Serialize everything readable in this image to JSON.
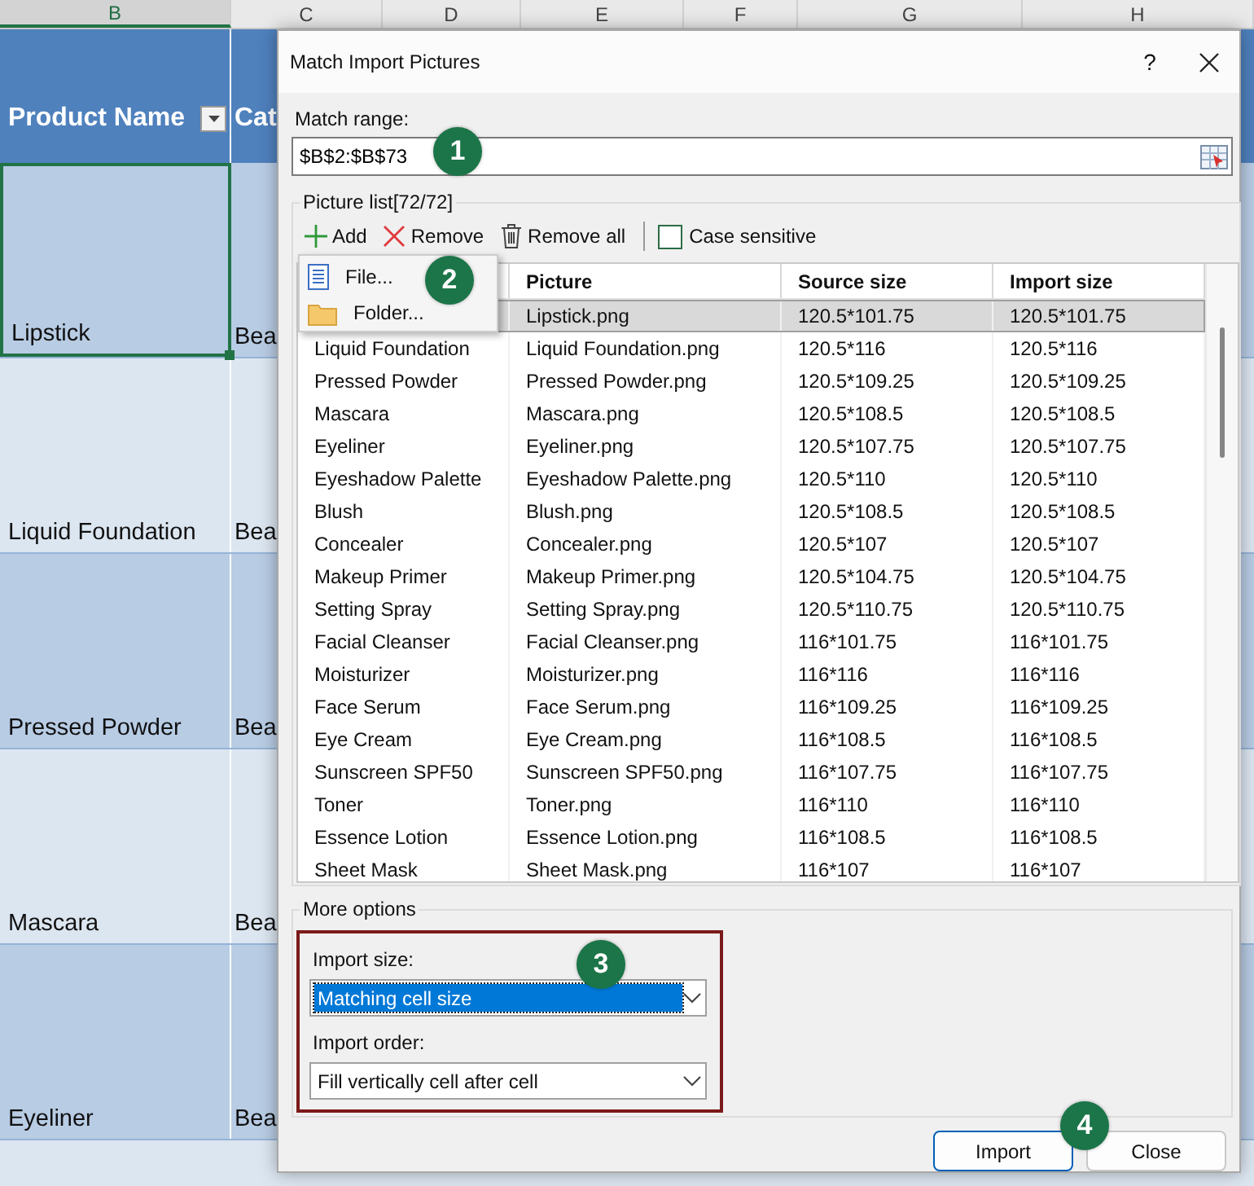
{
  "sheet": {
    "column_headers": [
      {
        "label": "B",
        "selected": true
      },
      {
        "label": "C",
        "selected": false
      },
      {
        "label": "D",
        "selected": false
      },
      {
        "label": "E",
        "selected": false
      },
      {
        "label": "F",
        "selected": false
      },
      {
        "label": "G",
        "selected": false
      },
      {
        "label": "H",
        "selected": false
      }
    ],
    "header_cells": [
      "Product Name",
      "Cat"
    ],
    "rows": [
      {
        "product": "Lipstick",
        "column_c": "Bea",
        "selected": true
      },
      {
        "product": "Liquid Foundation",
        "column_c": "Bea",
        "selected": false
      },
      {
        "product": "Pressed Powder",
        "column_c": "Bea",
        "selected": false
      },
      {
        "product": "Mascara",
        "column_c": "Bea",
        "selected": false
      },
      {
        "product": "Eyeliner",
        "column_c": "Bea",
        "selected": false
      }
    ]
  },
  "dialog": {
    "title": "Match Import Pictures",
    "help": "?",
    "match_range": {
      "label": "Match range:",
      "value": "$B$2:$B$73"
    },
    "picture_list": {
      "title": "Picture list[72/72]",
      "toolbar": [
        {
          "label": "Add",
          "kind": "add"
        },
        {
          "label": "Remove",
          "kind": "remove"
        },
        {
          "label": "Remove all",
          "kind": "remove_all"
        }
      ],
      "case_sensitive": {
        "label": "Case sensitive",
        "checked": false
      },
      "add_menu": [
        {
          "label": "File...",
          "kind": "file"
        },
        {
          "label": "Folder...",
          "kind": "folder"
        }
      ],
      "columns": [
        "Picture",
        "Source size",
        "Import size"
      ],
      "rows": [
        {
          "picture": "Lipstick.png",
          "source_size": "120.5*101.75",
          "import_size": "120.5*101.75",
          "selected": true
        },
        {
          "name": "Liquid Foundation",
          "picture": "Liquid Foundation.png",
          "source_size": "120.5*116",
          "import_size": "120.5*116",
          "selected": false
        },
        {
          "name": "Pressed Powder",
          "picture": "Pressed Powder.png",
          "source_size": "120.5*109.25",
          "import_size": "120.5*109.25",
          "selected": false
        },
        {
          "name": "Mascara",
          "picture": "Mascara.png",
          "source_size": "120.5*108.5",
          "import_size": "120.5*108.5",
          "selected": false
        },
        {
          "name": "Eyeliner",
          "picture": "Eyeliner.png",
          "source_size": "120.5*107.75",
          "import_size": "120.5*107.75",
          "selected": false
        },
        {
          "name": "Eyeshadow Palette",
          "picture": "Eyeshadow Palette.png",
          "source_size": "120.5*110",
          "import_size": "120.5*110",
          "selected": false
        },
        {
          "name": "Blush",
          "picture": "Blush.png",
          "source_size": "120.5*108.5",
          "import_size": "120.5*108.5",
          "selected": false
        },
        {
          "name": "Concealer",
          "picture": "Concealer.png",
          "source_size": "120.5*107",
          "import_size": "120.5*107",
          "selected": false
        },
        {
          "name": "Makeup Primer",
          "picture": "Makeup Primer.png",
          "source_size": "120.5*104.75",
          "import_size": "120.5*104.75",
          "selected": false
        },
        {
          "name": "Setting Spray",
          "picture": "Setting Spray.png",
          "source_size": "120.5*110.75",
          "import_size": "120.5*110.75",
          "selected": false
        },
        {
          "name": "Facial Cleanser",
          "picture": "Facial Cleanser.png",
          "source_size": "116*101.75",
          "import_size": "116*101.75",
          "selected": false
        },
        {
          "name": "Moisturizer",
          "picture": "Moisturizer.png",
          "source_size": "116*116",
          "import_size": "116*116",
          "selected": false
        },
        {
          "name": "Face Serum",
          "picture": "Face Serum.png",
          "source_size": "116*109.25",
          "import_size": "116*109.25",
          "selected": false
        },
        {
          "name": "Eye Cream",
          "picture": "Eye Cream.png",
          "source_size": "116*108.5",
          "import_size": "116*108.5",
          "selected": false
        },
        {
          "name": "Sunscreen SPF50",
          "picture": "Sunscreen SPF50.png",
          "source_size": "116*107.75",
          "import_size": "116*107.75",
          "selected": false
        },
        {
          "name": "Toner",
          "picture": "Toner.png",
          "source_size": "116*110",
          "import_size": "116*110",
          "selected": false
        },
        {
          "name": "Essence Lotion",
          "picture": "Essence Lotion.png",
          "source_size": "116*108.5",
          "import_size": "116*108.5",
          "selected": false
        },
        {
          "name": "Sheet Mask",
          "picture": "Sheet Mask.png",
          "source_size": "116*107",
          "import_size": "116*107",
          "selected": false
        }
      ]
    },
    "more_options": {
      "title": "More options",
      "fields": [
        {
          "label": "Import size:",
          "value": "Matching cell size",
          "focused": true
        },
        {
          "label": "Import order:",
          "value": "Fill vertically cell after cell",
          "focused": false
        }
      ]
    },
    "buttons": [
      {
        "label": "Import",
        "default": true
      },
      {
        "label": "Close",
        "default": false
      }
    ]
  },
  "callouts": [
    "1",
    "2",
    "3",
    "4"
  ]
}
